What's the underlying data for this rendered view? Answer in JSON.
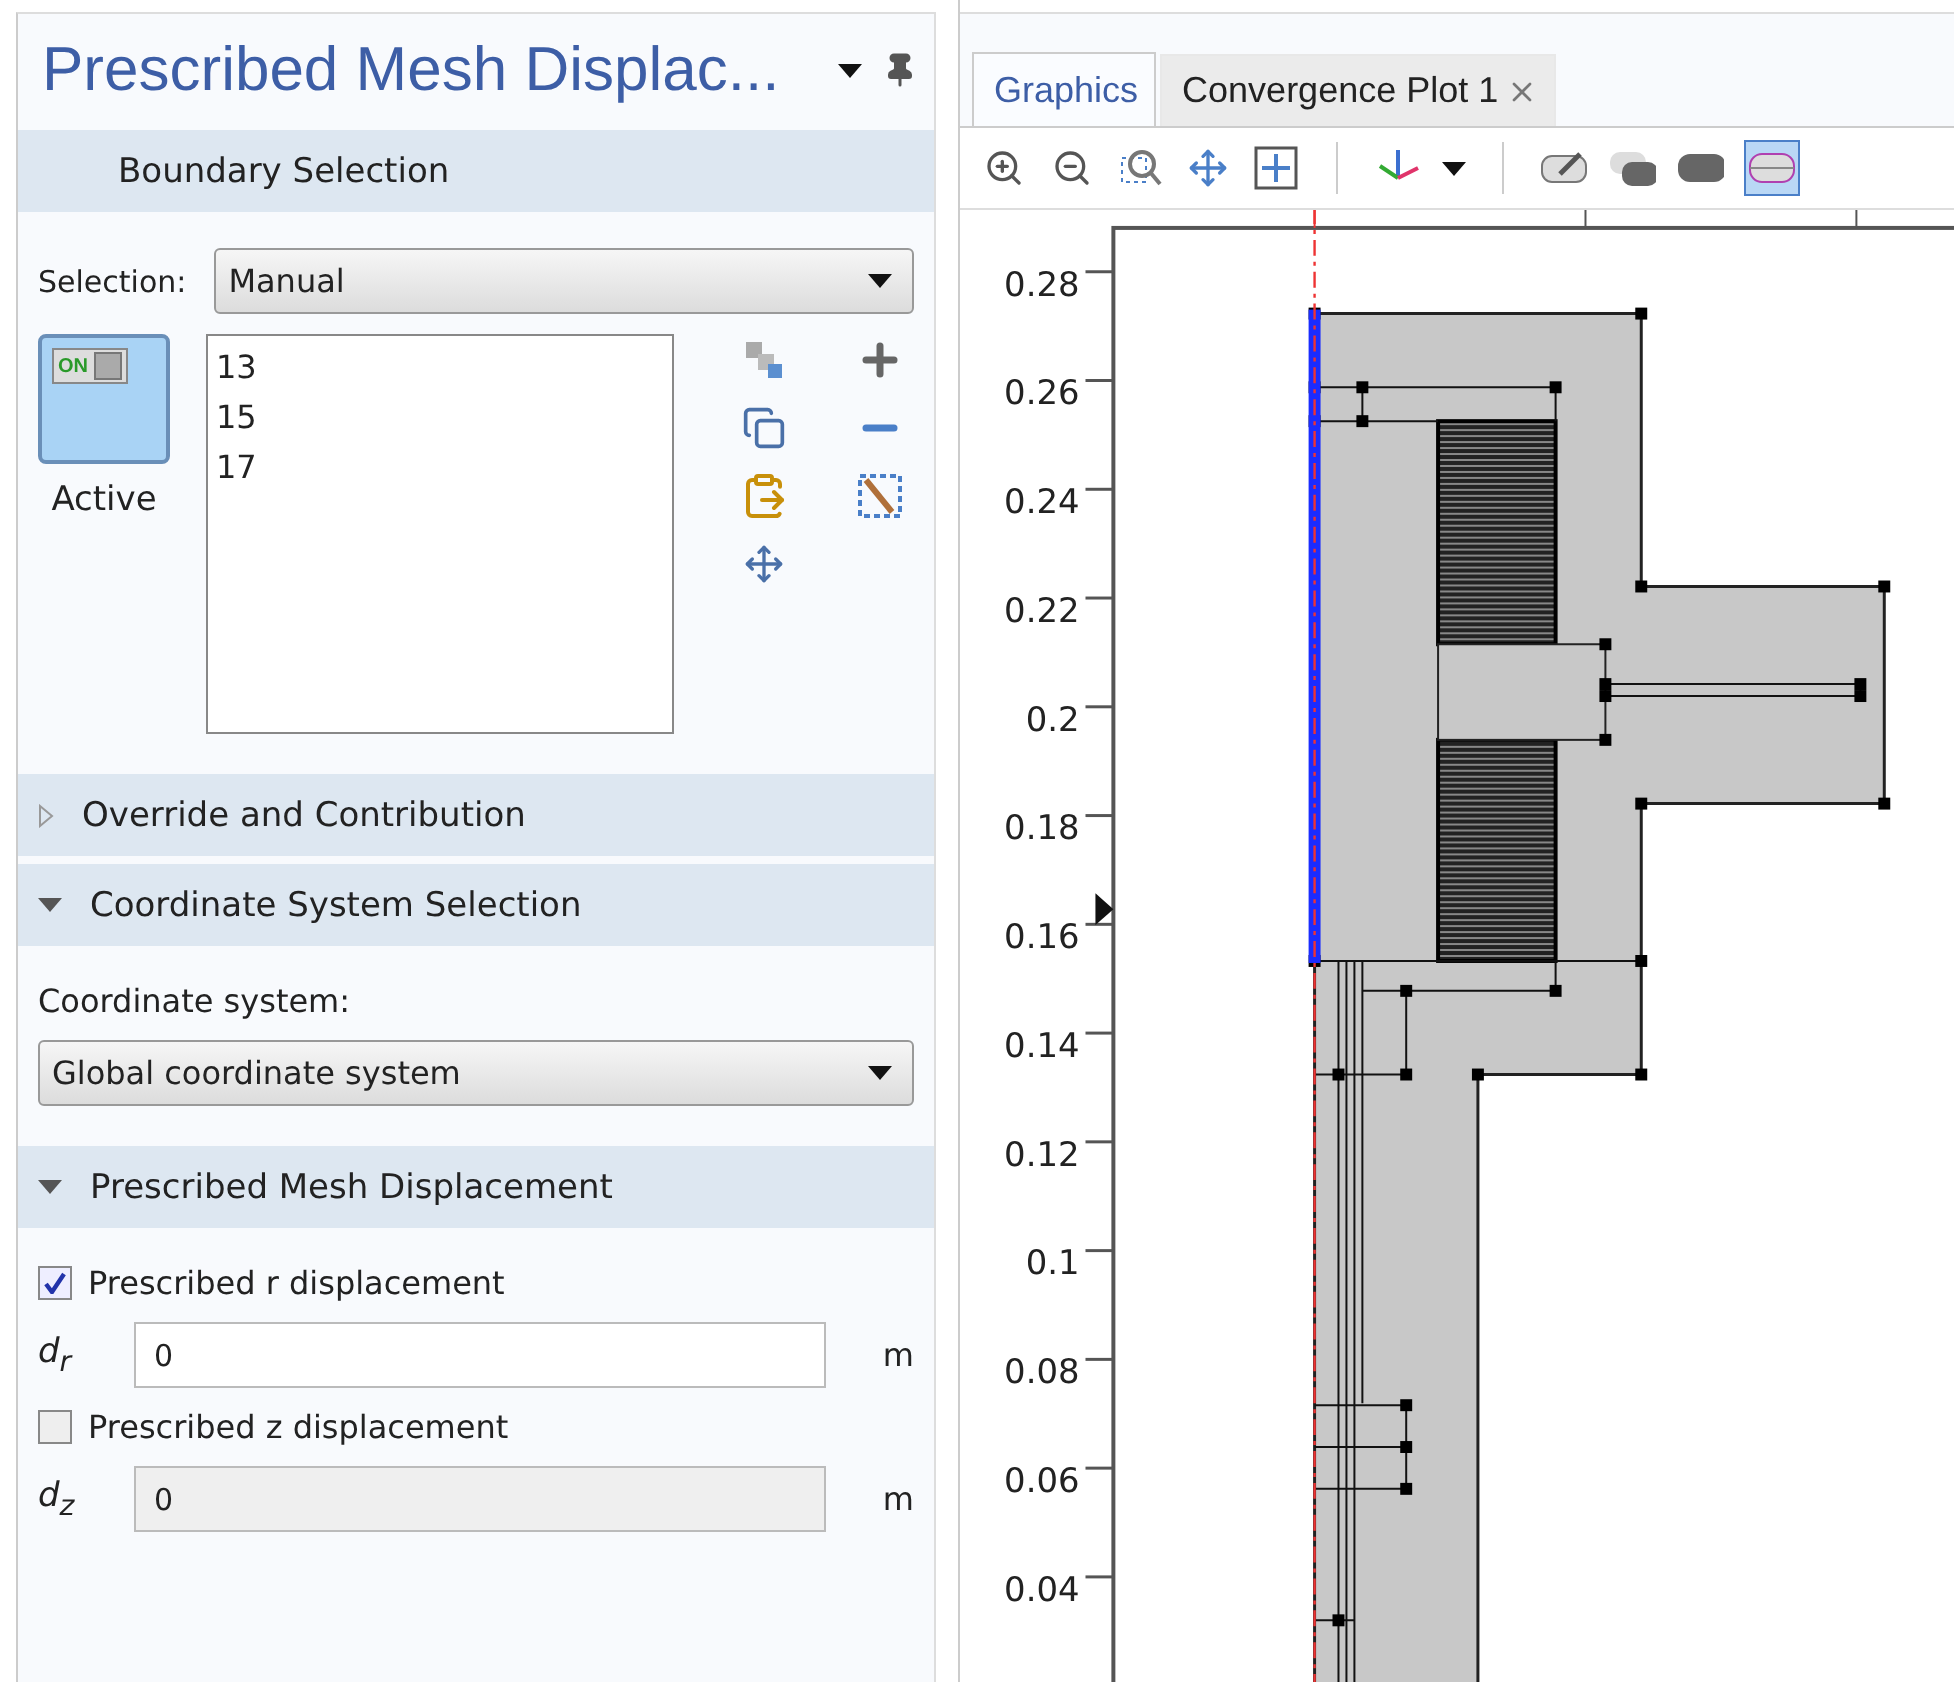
{
  "settings": {
    "title": "Prescribed Mesh Displac...",
    "boundary_selection": {
      "header": "Boundary Selection",
      "selection_label": "Selection:",
      "selection_value": "Manual",
      "active": {
        "switch_text": "ON",
        "label": "Active",
        "on": true
      },
      "items": [
        "13",
        "15",
        "17"
      ]
    },
    "override": {
      "header": "Override and Contribution",
      "expanded": false
    },
    "coordinate": {
      "header": "Coordinate System Selection",
      "expanded": true,
      "label": "Coordinate system:",
      "value": "Global coordinate system"
    },
    "displacement": {
      "header": "Prescribed Mesh Displacement",
      "expanded": true,
      "components": [
        {
          "label": "Prescribed r displacement",
          "checked": true,
          "symbol": "d$_{r}$",
          "value": "0",
          "unit": "m"
        },
        {
          "label": "Prescribed z displacement",
          "checked": false,
          "symbol": "d$_{z}$",
          "value": "0",
          "unit": "m"
        }
      ]
    }
  },
  "graphics": {
    "tabs": [
      {
        "label": "Graphics",
        "selected": true,
        "closable": false
      },
      {
        "label": "Convergence Plot 1",
        "selected": false,
        "closable": true
      }
    ],
    "y_tick_labels": [
      "0.28",
      "0.26",
      "0.24",
      "0.22",
      "0.2",
      "0.18",
      "0.16",
      "0.14",
      "0.12",
      "0.1",
      "0.08",
      "0.06",
      "0.04"
    ]
  }
}
